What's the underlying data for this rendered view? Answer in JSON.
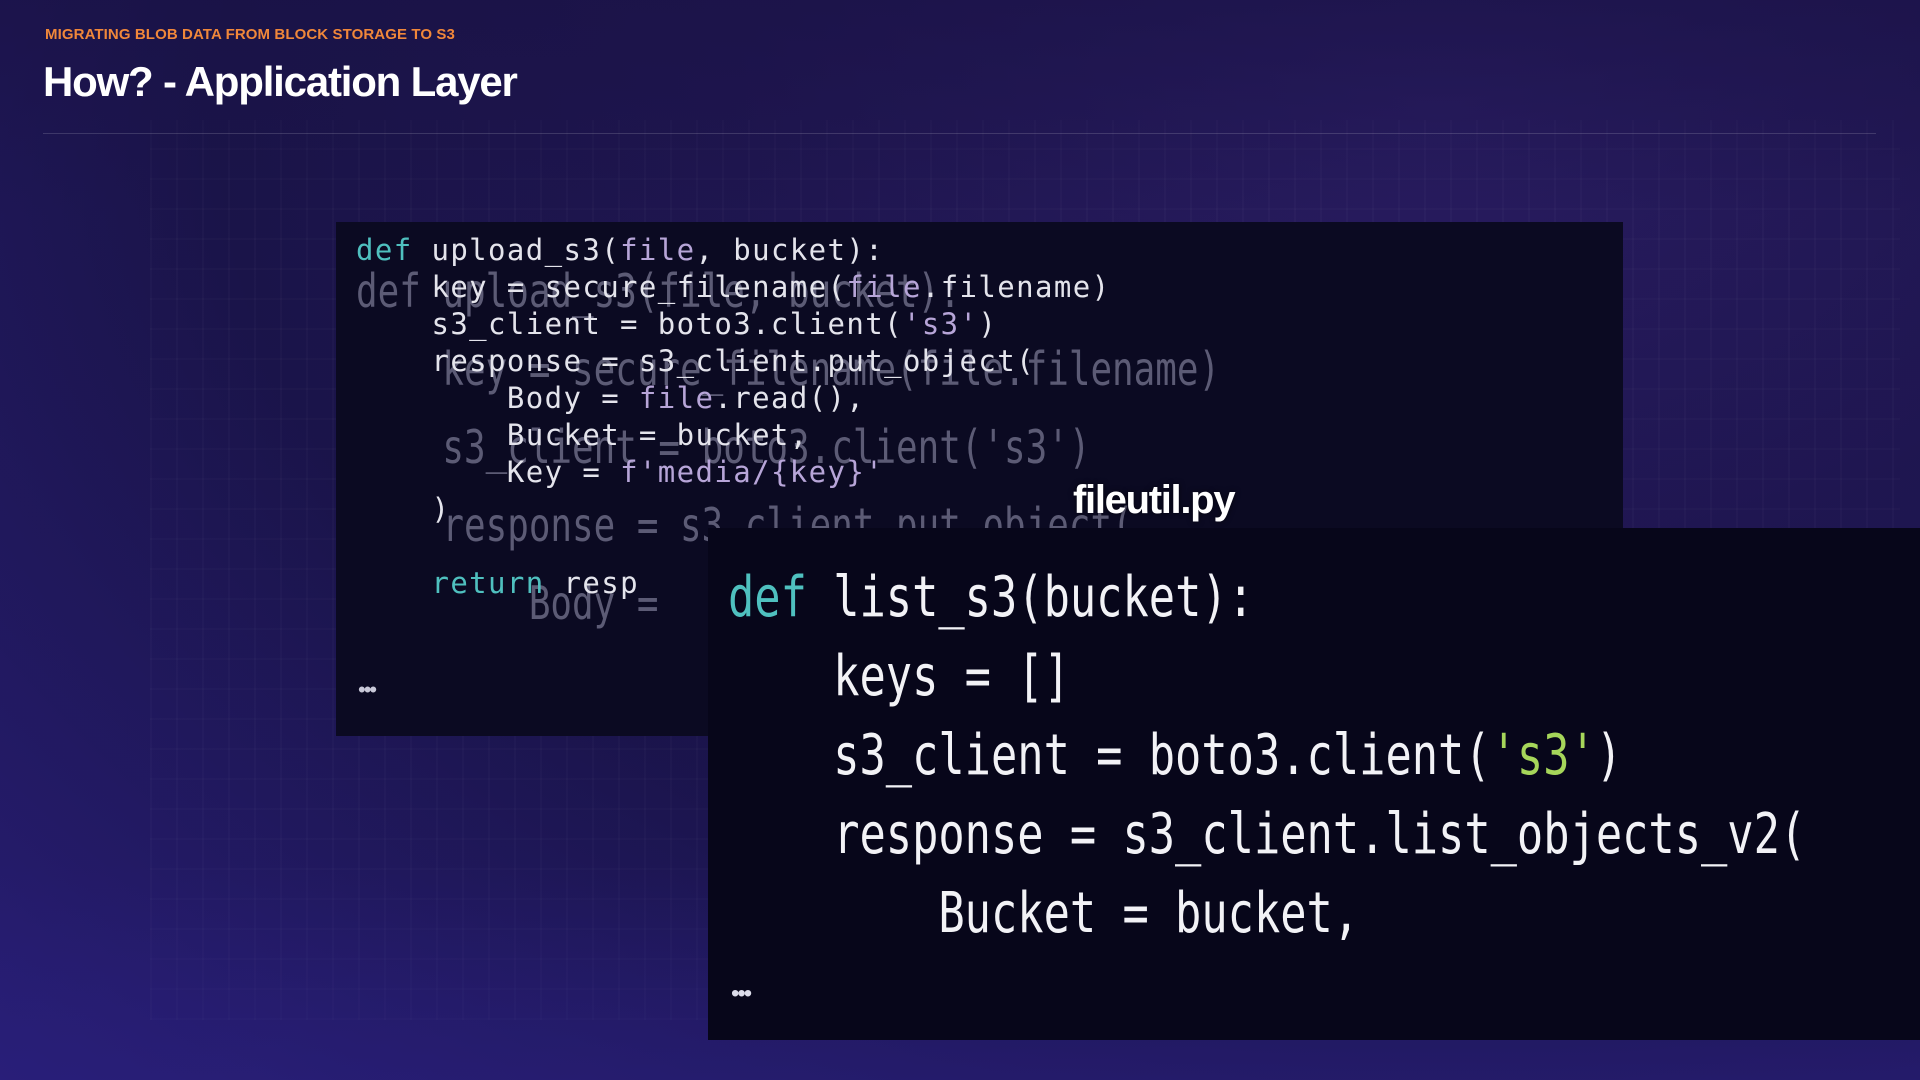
{
  "slide": {
    "kicker": "MIGRATING BLOB DATA FROM BLOCK STORAGE TO S3",
    "title": "How? - Application Layer"
  },
  "back_snippet": {
    "lines": [
      {
        "indent": "",
        "kw": "def",
        "text": " upload_s3(",
        "str": "file",
        "rest": ", bucket):"
      },
      {
        "indent": "    ",
        "kw": "",
        "text": "key = secure_filename(",
        "str": "file",
        "rest": ".filename)"
      },
      {
        "indent": "    ",
        "kw": "",
        "text": "s3_client = boto3.client(",
        "str": "'s3'",
        "rest": ")"
      },
      {
        "indent": "    ",
        "kw": "",
        "text": "response = s3_client.put_object(",
        "str": "",
        "rest": ""
      },
      {
        "indent": "        ",
        "kw": "",
        "text": "Body = ",
        "str": "file",
        "rest": ".read(),"
      },
      {
        "indent": "        ",
        "kw": "",
        "text": "Bucket = bucket,",
        "str": "",
        "rest": ""
      },
      {
        "indent": "        ",
        "kw": "",
        "text": "Key = ",
        "str": "f'media/{key}'",
        "rest": ""
      },
      {
        "indent": "    ",
        "kw": "",
        "text": ")",
        "str": "",
        "rest": ""
      },
      {
        "indent": "",
        "kw": "",
        "text": "",
        "str": "",
        "rest": ""
      },
      {
        "indent": "    ",
        "kw": "return",
        "text": " resp",
        "str": "",
        "rest": ""
      }
    ],
    "ellipsis": "•••"
  },
  "ghost_snippet": {
    "lines": [
      "def upload_s3(file, bucket):",
      "    key = secure_filename(file.filename)",
      "    s3_client = boto3.client('s3')",
      "    response = s3_client.put_object(",
      "        Body ="
    ]
  },
  "filename_label": "fileutil.py",
  "front_snippet": {
    "lines": [
      {
        "indent": "",
        "kw": "def",
        "text": " list_s3(bucket):",
        "str": "",
        "rest": ""
      },
      {
        "indent": "    ",
        "kw": "",
        "text": "keys = []",
        "str": "",
        "rest": ""
      },
      {
        "indent": "    ",
        "kw": "",
        "text": "s3_client = boto3.client(",
        "str": "'s3'",
        "rest": ")"
      },
      {
        "indent": "    ",
        "kw": "",
        "text": "response = s3_client.list_objects_v2(",
        "str": "",
        "rest": ""
      },
      {
        "indent": "        ",
        "kw": "",
        "text": "Bucket = bucket,",
        "str": "",
        "rest": ""
      }
    ],
    "ellipsis": "•••"
  },
  "colors": {
    "kicker": "#f0873a",
    "keyword": "#4fc0bf",
    "string_back": "#b7a5d8",
    "string_front": "#a6d65a",
    "background": "#1f1650"
  }
}
